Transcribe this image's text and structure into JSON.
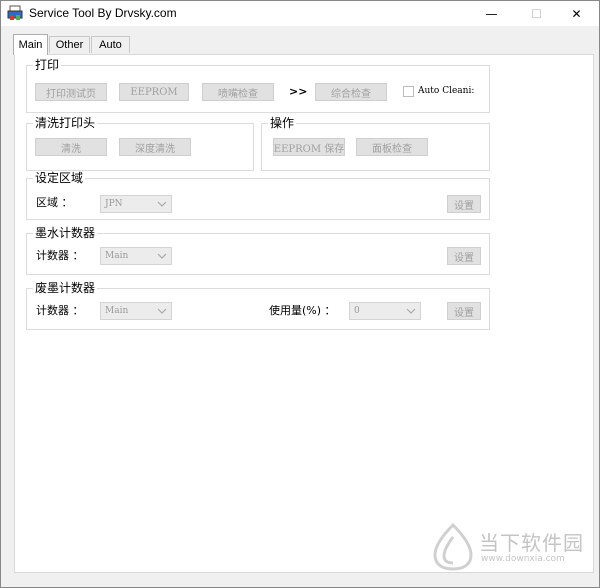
{
  "window": {
    "title": "Service Tool By Drvsky.com",
    "minimize": "—",
    "maximize": "☐",
    "close": "✕"
  },
  "tabs": [
    "Main",
    "Other",
    "Auto"
  ],
  "print_group": {
    "title": "打印",
    "buttons": [
      "打印测试页",
      "EEPROM",
      "喷嘴检查",
      "综合检查"
    ],
    "arrows": ">>",
    "auto_clean_label": "Auto Cleani:"
  },
  "clean_group": {
    "title": "清洗打印头",
    "buttons": [
      "清洗",
      "深度清洗"
    ]
  },
  "ops_group": {
    "title": "操作",
    "buttons": [
      "EEPROM 保存",
      "面板检查"
    ]
  },
  "region_group": {
    "title": "设定区域",
    "label": "区域 ：",
    "select_value": "JPN",
    "set_button": "设置"
  },
  "ink_group": {
    "title": "墨水计数器",
    "label": "计数器 ：",
    "select_value": "Main",
    "set_button": "设置"
  },
  "waste_group": {
    "title": "废墨计数器",
    "label": "计数器 ：",
    "select_value": "Main",
    "usage_label": "使用量(%) ：",
    "usage_value": "0",
    "set_button": "设置"
  },
  "watermark": {
    "text": "当下软件园",
    "url": "www.downxia.com"
  }
}
